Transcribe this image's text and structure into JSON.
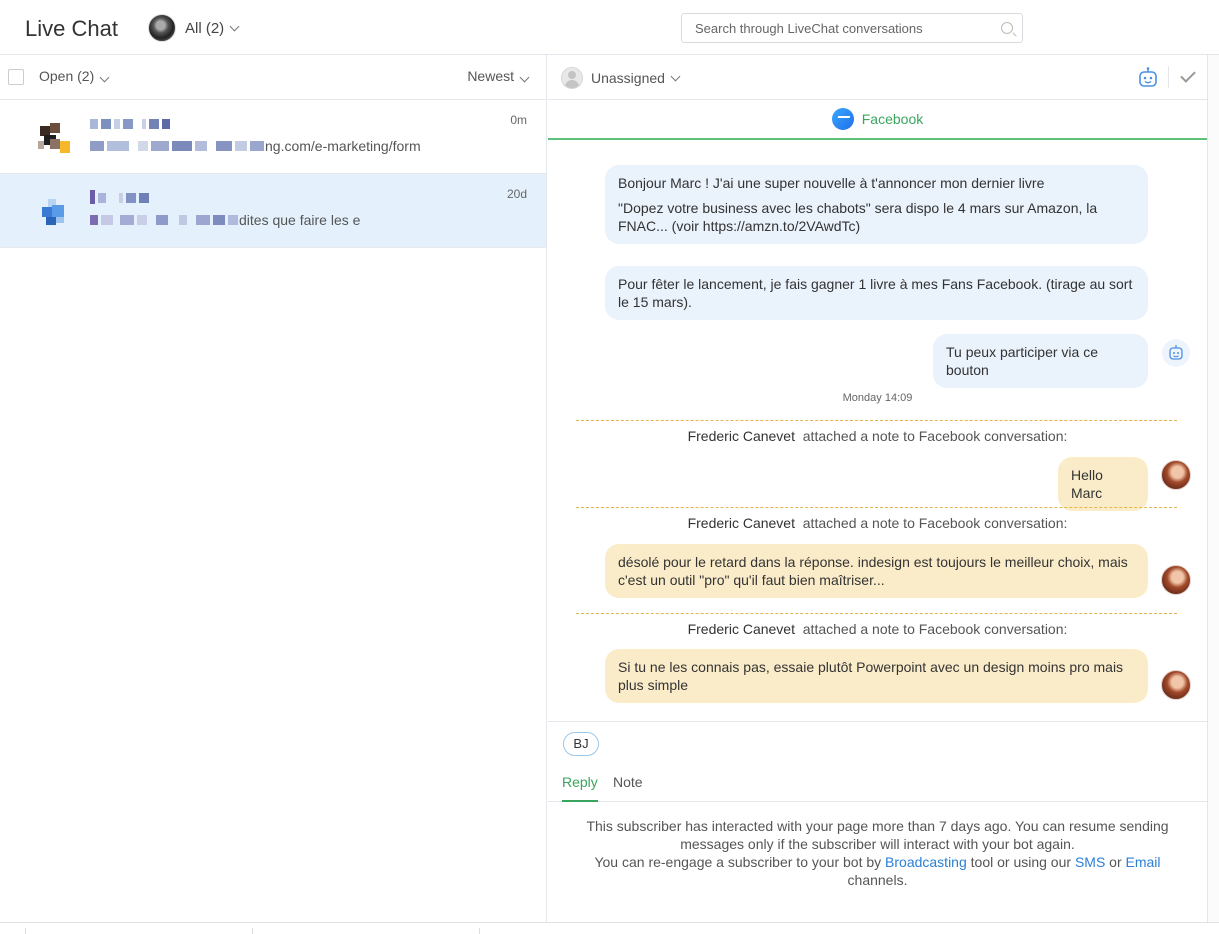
{
  "app": {
    "title": "Live Chat"
  },
  "filter": {
    "label": "All (2)"
  },
  "search": {
    "placeholder": "Search through LiveChat conversations"
  },
  "list": {
    "status_filter": "Open (2)",
    "sort": "Newest",
    "conversations": [
      {
        "preview_suffix": "ng.com/e-marketing/form",
        "time": "0m"
      },
      {
        "preview_suffix": "dites que faire les e",
        "time": "20d"
      }
    ]
  },
  "chat": {
    "assignee": "Unassigned",
    "channel": "Facebook",
    "messages": {
      "m1_line1": "Bonjour Marc ! J'ai une super nouvelle à t'annoncer mon dernier livre",
      "m1_line2": "\"Dopez votre business avec les chabots\" sera dispo le 4 mars sur Amazon, la FNAC... (voir https://amzn.to/2VAwdTc)",
      "m2": "Pour fêter le lancement, je fais gagner 1 livre à mes Fans Facebook. (tirage au sort le 15 mars).",
      "m3": "Tu peux participer via ce bouton",
      "day": "Monday 14:09",
      "note_author": "Frederic Canevet",
      "note_action": "attached a note to Facebook conversation:",
      "n1": "Hello Marc",
      "n2": "désolé pour le retard dans la réponse. indesign est toujours le meilleur choix, mais c'est un outil \"pro\" qu'il faut bien maîtriser...",
      "n3": "Si tu ne les connais pas, essaie plutôt Powerpoint avec un design moins pro mais plus simple"
    }
  },
  "composer": {
    "initials": "BJ",
    "tabs": {
      "reply": "Reply",
      "note": "Note"
    },
    "info_line1": "This subscriber has interacted with your page more than 7 days ago. You can resume sending messages only if the subscriber will interact with your bot again.",
    "info_prefix": "You can re-engage a subscriber to your bot by",
    "link_broadcasting": "Broadcasting",
    "info_mid": "tool or using our",
    "link_sms": "SMS",
    "info_or": "or",
    "link_email": "Email",
    "info_suffix": "channels."
  },
  "colors": {
    "accent_green": "#3aa55e",
    "link_blue": "#2b7fd4",
    "bubble_blue": "#eaf2fc",
    "note_yellow": "#fbecc9"
  }
}
